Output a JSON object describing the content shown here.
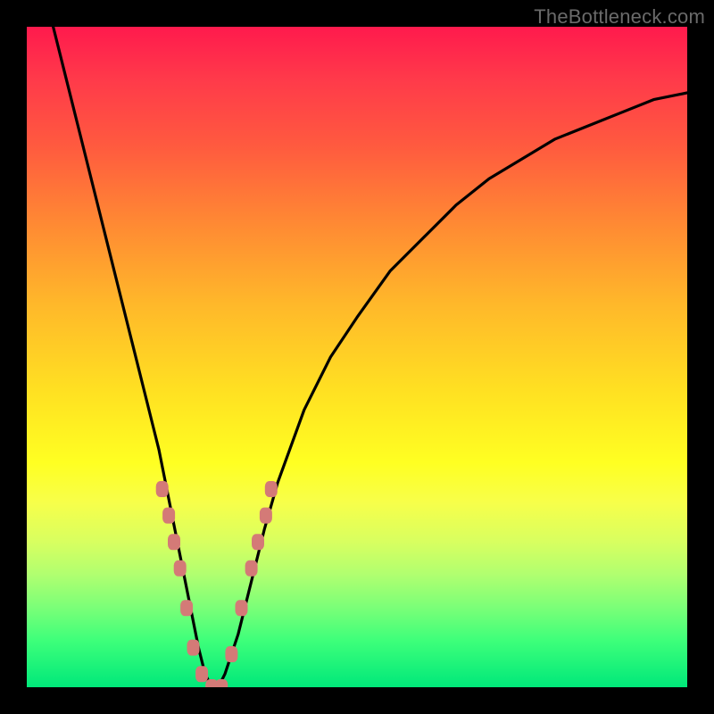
{
  "source_label": "TheBottleneck.com",
  "colors": {
    "curve": "#000000",
    "marker": "#d47a77",
    "gradient_top": "#ff1a4d",
    "gradient_bottom": "#00e87a"
  },
  "chart_data": {
    "type": "line",
    "title": "",
    "xlabel": "",
    "ylabel": "",
    "xlim": [
      0,
      100
    ],
    "ylim": [
      0,
      100
    ],
    "curve": {
      "x": [
        4,
        6,
        8,
        10,
        12,
        14,
        16,
        18,
        20,
        22,
        23,
        24,
        25,
        26,
        27,
        28,
        29,
        30,
        32,
        34,
        36,
        38,
        42,
        46,
        50,
        55,
        60,
        65,
        70,
        75,
        80,
        85,
        90,
        95,
        100
      ],
      "y": [
        100,
        92,
        84,
        76,
        68,
        60,
        52,
        44,
        36,
        26,
        21,
        16,
        11,
        6,
        2,
        0,
        0,
        2,
        8,
        16,
        24,
        31,
        42,
        50,
        56,
        63,
        68,
        73,
        77,
        80,
        83,
        85,
        87,
        89,
        90
      ]
    },
    "markers": {
      "x": [
        20.5,
        21.5,
        22.3,
        23.2,
        24.2,
        25.2,
        26.5,
        28.0,
        29.5,
        31.0,
        32.5,
        34.0,
        35.0,
        36.2,
        37.0
      ],
      "y": [
        30,
        26,
        22,
        18,
        12,
        6,
        2,
        0,
        0,
        5,
        12,
        18,
        22,
        26,
        30
      ]
    }
  }
}
